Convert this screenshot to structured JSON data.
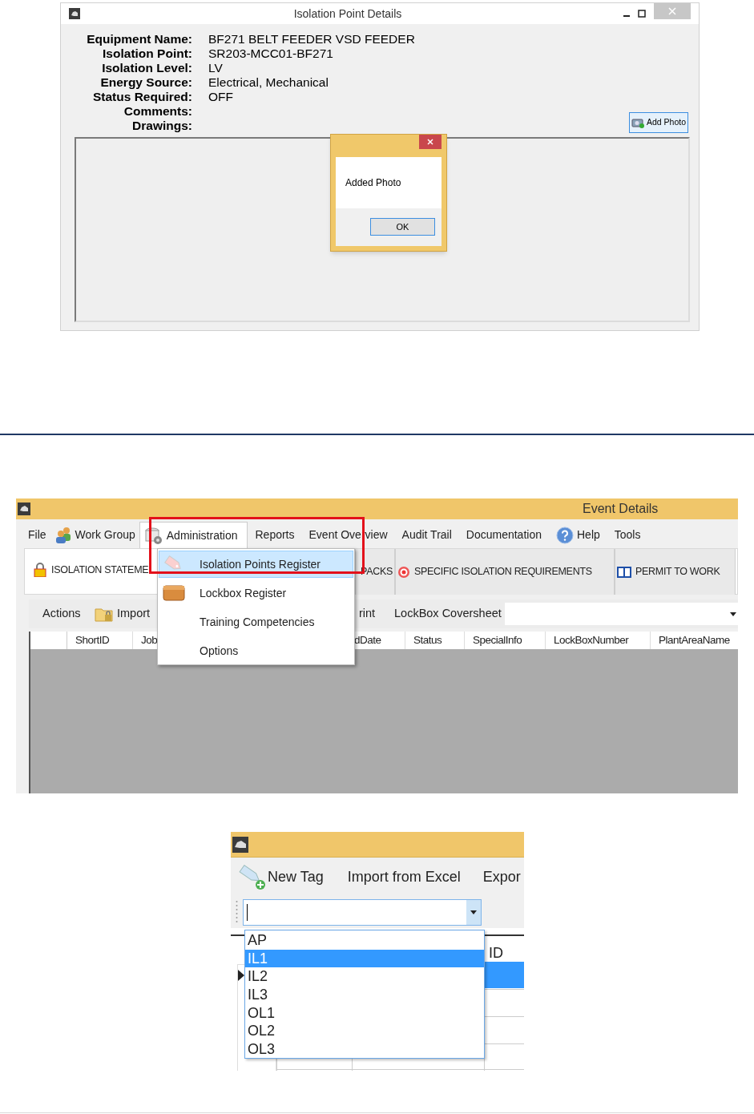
{
  "details_window": {
    "title": "Isolation Point Details",
    "fields": [
      {
        "label": "Equipment Name:",
        "value": "BF271 BELT FEEDER VSD FEEDER"
      },
      {
        "label": "Isolation Point:",
        "value": "SR203-MCC01-BF271"
      },
      {
        "label": "Isolation Level:",
        "value": "LV"
      },
      {
        "label": "Energy Source:",
        "value": "Electrical, Mechanical"
      },
      {
        "label": "Status Required:",
        "value": "OFF"
      },
      {
        "label": "Comments:"
      },
      {
        "label": "Drawings:"
      }
    ],
    "add_photo_button": "Add Photo",
    "message_box": {
      "text": "Added Photo",
      "ok_button": "OK"
    }
  },
  "event_window": {
    "title": "Event Details",
    "menu": [
      {
        "label": "File",
        "kind": "plain",
        "selected": false
      },
      {
        "label": "Work Group",
        "kind": "people",
        "selected": false
      },
      {
        "label": "Administration",
        "kind": "admin",
        "selected": true
      },
      {
        "label": "Reports",
        "kind": "plain",
        "selected": false
      },
      {
        "label": "Event Overview",
        "kind": "plain",
        "selected": false
      },
      {
        "label": "Audit Trail",
        "kind": "plain",
        "selected": false
      },
      {
        "label": "Documentation",
        "kind": "plain",
        "selected": false
      },
      {
        "label": "Help",
        "kind": "help",
        "selected": false
      },
      {
        "label": "Tools",
        "kind": "plain",
        "selected": false
      }
    ],
    "admin_menu": [
      {
        "label": "Isolation Points Register",
        "kind": "tag",
        "selected": true
      },
      {
        "label": "Lockbox Register",
        "kind": "box",
        "selected": false
      },
      {
        "label": "Training Competencies",
        "kind": "none",
        "selected": false
      },
      {
        "label": "Options",
        "kind": "none",
        "selected": false
      }
    ],
    "tabs": [
      {
        "label": "ISOLATION STATEME",
        "kind": "lock",
        "selected": true
      },
      {
        "label": "PACKS",
        "kind": "none",
        "selected": false
      },
      {
        "label": "SPECIFIC ISOLATION REQUIREMENTS",
        "kind": "target",
        "selected": false
      },
      {
        "label": "PERMIT TO WORK",
        "kind": "book",
        "selected": false
      }
    ],
    "toolbar": [
      {
        "label": "Actions",
        "kind": "plain"
      },
      {
        "label": "Import",
        "kind": "folder"
      },
      {
        "label": "rint",
        "kind": "plain"
      },
      {
        "label": "LockBox Coversheet",
        "kind": "plain"
      }
    ],
    "columns": [
      "ShortID",
      "Job",
      "dDate",
      "Status",
      "SpecialInfo",
      "LockBoxNumber",
      "PlantAreaName"
    ]
  },
  "tag_window": {
    "toolbar": [
      "New Tag",
      "Import from Excel",
      "Expor"
    ],
    "grid_header": "ID",
    "options": [
      {
        "label": "AP",
        "selected": false
      },
      {
        "label": "IL1",
        "selected": true
      },
      {
        "label": "IL2",
        "selected": false
      },
      {
        "label": "IL3",
        "selected": false
      },
      {
        "label": "OL1",
        "selected": false
      },
      {
        "label": "OL2",
        "selected": false
      },
      {
        "label": "OL3",
        "selected": false
      }
    ]
  }
}
